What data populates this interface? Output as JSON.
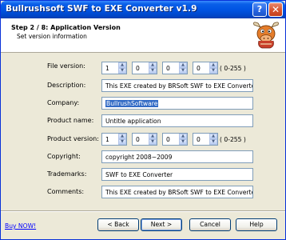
{
  "window": {
    "title": "Bullrushsoft SWF to EXE Converter v1.9",
    "help_glyph": "?",
    "close_glyph": "✕"
  },
  "header": {
    "step_title": "Step 2 / 8: Application Version",
    "subtitle": "Set version information"
  },
  "form": {
    "file_version": {
      "label": "File version:",
      "parts": [
        "1",
        "0",
        "0",
        "0"
      ],
      "range_hint": "( 0-255 )"
    },
    "description": {
      "label": "Description:",
      "value": "This EXE created by BRSoft SWF to EXE Converter"
    },
    "company": {
      "label": "Company:",
      "value": "BullrushSoftware"
    },
    "product_name": {
      "label": "Product name:",
      "value": "Untitle application"
    },
    "product_version": {
      "label": "Product version:",
      "parts": [
        "1",
        "0",
        "0",
        "0"
      ],
      "range_hint": "( 0-255 )"
    },
    "copyright": {
      "label": "Copyright:",
      "value": "copyright 2008~2009"
    },
    "trademarks": {
      "label": "Trademarks:",
      "value": "SWF to EXE Converter"
    },
    "comments": {
      "label": "Comments:",
      "value": "This EXE created by BRSoft SWF to EXE Converter"
    }
  },
  "footer": {
    "buy_link": "Buy NOW!",
    "back": "< Back",
    "next": "Next >",
    "cancel": "Cancel",
    "help": "Help"
  },
  "colors": {
    "titlebar": "#0054e3",
    "window_bg": "#ece9d8",
    "link": "#0000ff",
    "selection": "#316ac5"
  },
  "icons": {
    "mascot": "bull-mascot-icon",
    "spinner": "spin-arrows-icon"
  }
}
